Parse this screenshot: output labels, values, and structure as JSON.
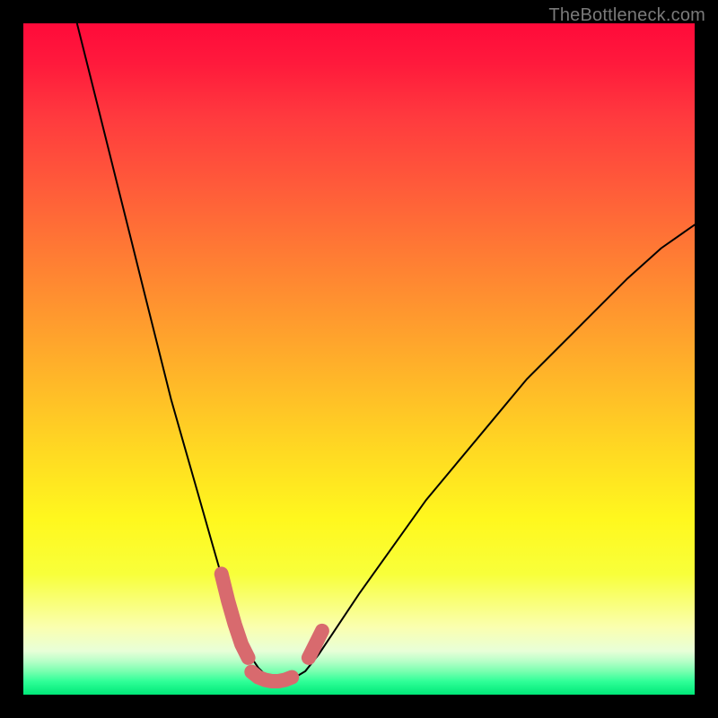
{
  "watermark": "TheBottleneck.com",
  "chart_data": {
    "type": "line",
    "title": "",
    "xlabel": "",
    "ylabel": "",
    "xlim": [
      0,
      100
    ],
    "ylim": [
      0,
      100
    ],
    "series": [
      {
        "name": "bottleneck-curve",
        "x": [
          8,
          10,
          12,
          14,
          16,
          18,
          20,
          22,
          24,
          26,
          28,
          30,
          31,
          32,
          33,
          34,
          35,
          36,
          37,
          38,
          39,
          40,
          42,
          44,
          46,
          50,
          55,
          60,
          65,
          70,
          75,
          80,
          85,
          90,
          95,
          100
        ],
        "y": [
          100,
          92,
          84,
          76,
          68,
          60,
          52,
          44,
          37,
          30,
          23,
          16,
          13,
          10,
          7.5,
          5.5,
          4,
          3,
          2.3,
          2,
          2,
          2.3,
          3.5,
          6,
          9,
          15,
          22,
          29,
          35,
          41,
          47,
          52,
          57,
          62,
          66.5,
          70
        ]
      },
      {
        "name": "highlight-left",
        "x": [
          29.5,
          30.5,
          31.5,
          32.5,
          33.5
        ],
        "y": [
          18,
          14,
          10.5,
          7.5,
          5.5
        ]
      },
      {
        "name": "highlight-bottom",
        "x": [
          34,
          35,
          36,
          37,
          38,
          39,
          40
        ],
        "y": [
          3.4,
          2.6,
          2.2,
          2.0,
          2.0,
          2.2,
          2.6
        ]
      },
      {
        "name": "highlight-right",
        "x": [
          42.5,
          43.5,
          44.5
        ],
        "y": [
          5.5,
          7.5,
          9.5
        ]
      }
    ],
    "highlight_color": "#d86a6e",
    "curve_color": "#000000"
  }
}
